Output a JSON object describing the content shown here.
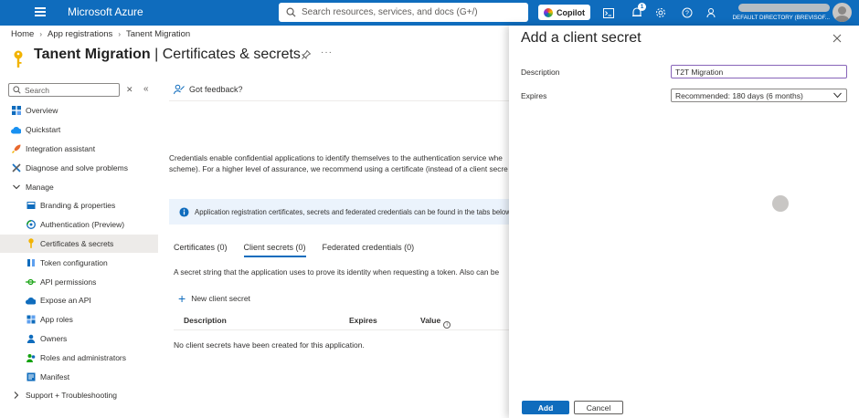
{
  "topbar": {
    "brand": "Microsoft Azure",
    "search_placeholder": "Search resources, services, and docs (G+/)",
    "copilot_label": "Copilot",
    "notification_count": "1",
    "directory": "DEFAULT DIRECTORY (BREVISOF..."
  },
  "breadcrumb": {
    "items": [
      "Home",
      "App registrations",
      "Tanent Migration"
    ]
  },
  "page": {
    "title_app": "Tanent Migration",
    "title_separator": " | ",
    "title_section": "Certificates & secrets",
    "more_label": "···"
  },
  "sidebar": {
    "search_placeholder": "Search",
    "items": [
      {
        "label": "Overview",
        "icon": "overview-icon"
      },
      {
        "label": "Quickstart",
        "icon": "quickstart-icon"
      },
      {
        "label": "Integration assistant",
        "icon": "rocket-icon"
      },
      {
        "label": "Diagnose and solve problems",
        "icon": "wrench-icon"
      },
      {
        "label": "Manage",
        "icon": "chevron-down-icon"
      },
      {
        "label": "Branding & properties",
        "icon": "branding-icon"
      },
      {
        "label": "Authentication (Preview)",
        "icon": "authentication-icon"
      },
      {
        "label": "Certificates & secrets",
        "icon": "key-icon"
      },
      {
        "label": "Token configuration",
        "icon": "token-icon"
      },
      {
        "label": "API permissions",
        "icon": "api-permissions-icon"
      },
      {
        "label": "Expose an API",
        "icon": "cloud-icon"
      },
      {
        "label": "App roles",
        "icon": "app-roles-icon"
      },
      {
        "label": "Owners",
        "icon": "owners-icon"
      },
      {
        "label": "Roles and administrators",
        "icon": "roles-icon"
      },
      {
        "label": "Manifest",
        "icon": "manifest-icon"
      },
      {
        "label": "Support + Troubleshooting",
        "icon": "chevron-right-icon"
      }
    ]
  },
  "main": {
    "feedback": "Got feedback?",
    "desc_line1": "Credentials enable confidential applications to identify themselves to the authentication service whe",
    "desc_line2": "scheme). For a higher level of assurance, we recommend using a certificate (instead of a client secre",
    "info_text": "Application registration certificates, secrets and federated credentials can be found in the tabs below",
    "tabs": [
      "Certificates (0)",
      "Client secrets (0)",
      "Federated credentials (0)"
    ],
    "tab_desc": "A secret string that the application uses to prove its identity when requesting a token. Also can be",
    "new_secret": "New client secret",
    "columns": [
      "Description",
      "Expires",
      "Value"
    ],
    "empty": "No client secrets have been created for this application."
  },
  "panel": {
    "title": "Add a client secret",
    "description_label": "Description",
    "description_value": "T2T Migration",
    "expires_label": "Expires",
    "expires_value": "Recommended: 180 days (6 months)",
    "add_label": "Add",
    "cancel_label": "Cancel"
  },
  "colors": {
    "brand": "#0f6cbd",
    "input_focus": "#8764b8",
    "info_bg": "#ebf3fc"
  }
}
